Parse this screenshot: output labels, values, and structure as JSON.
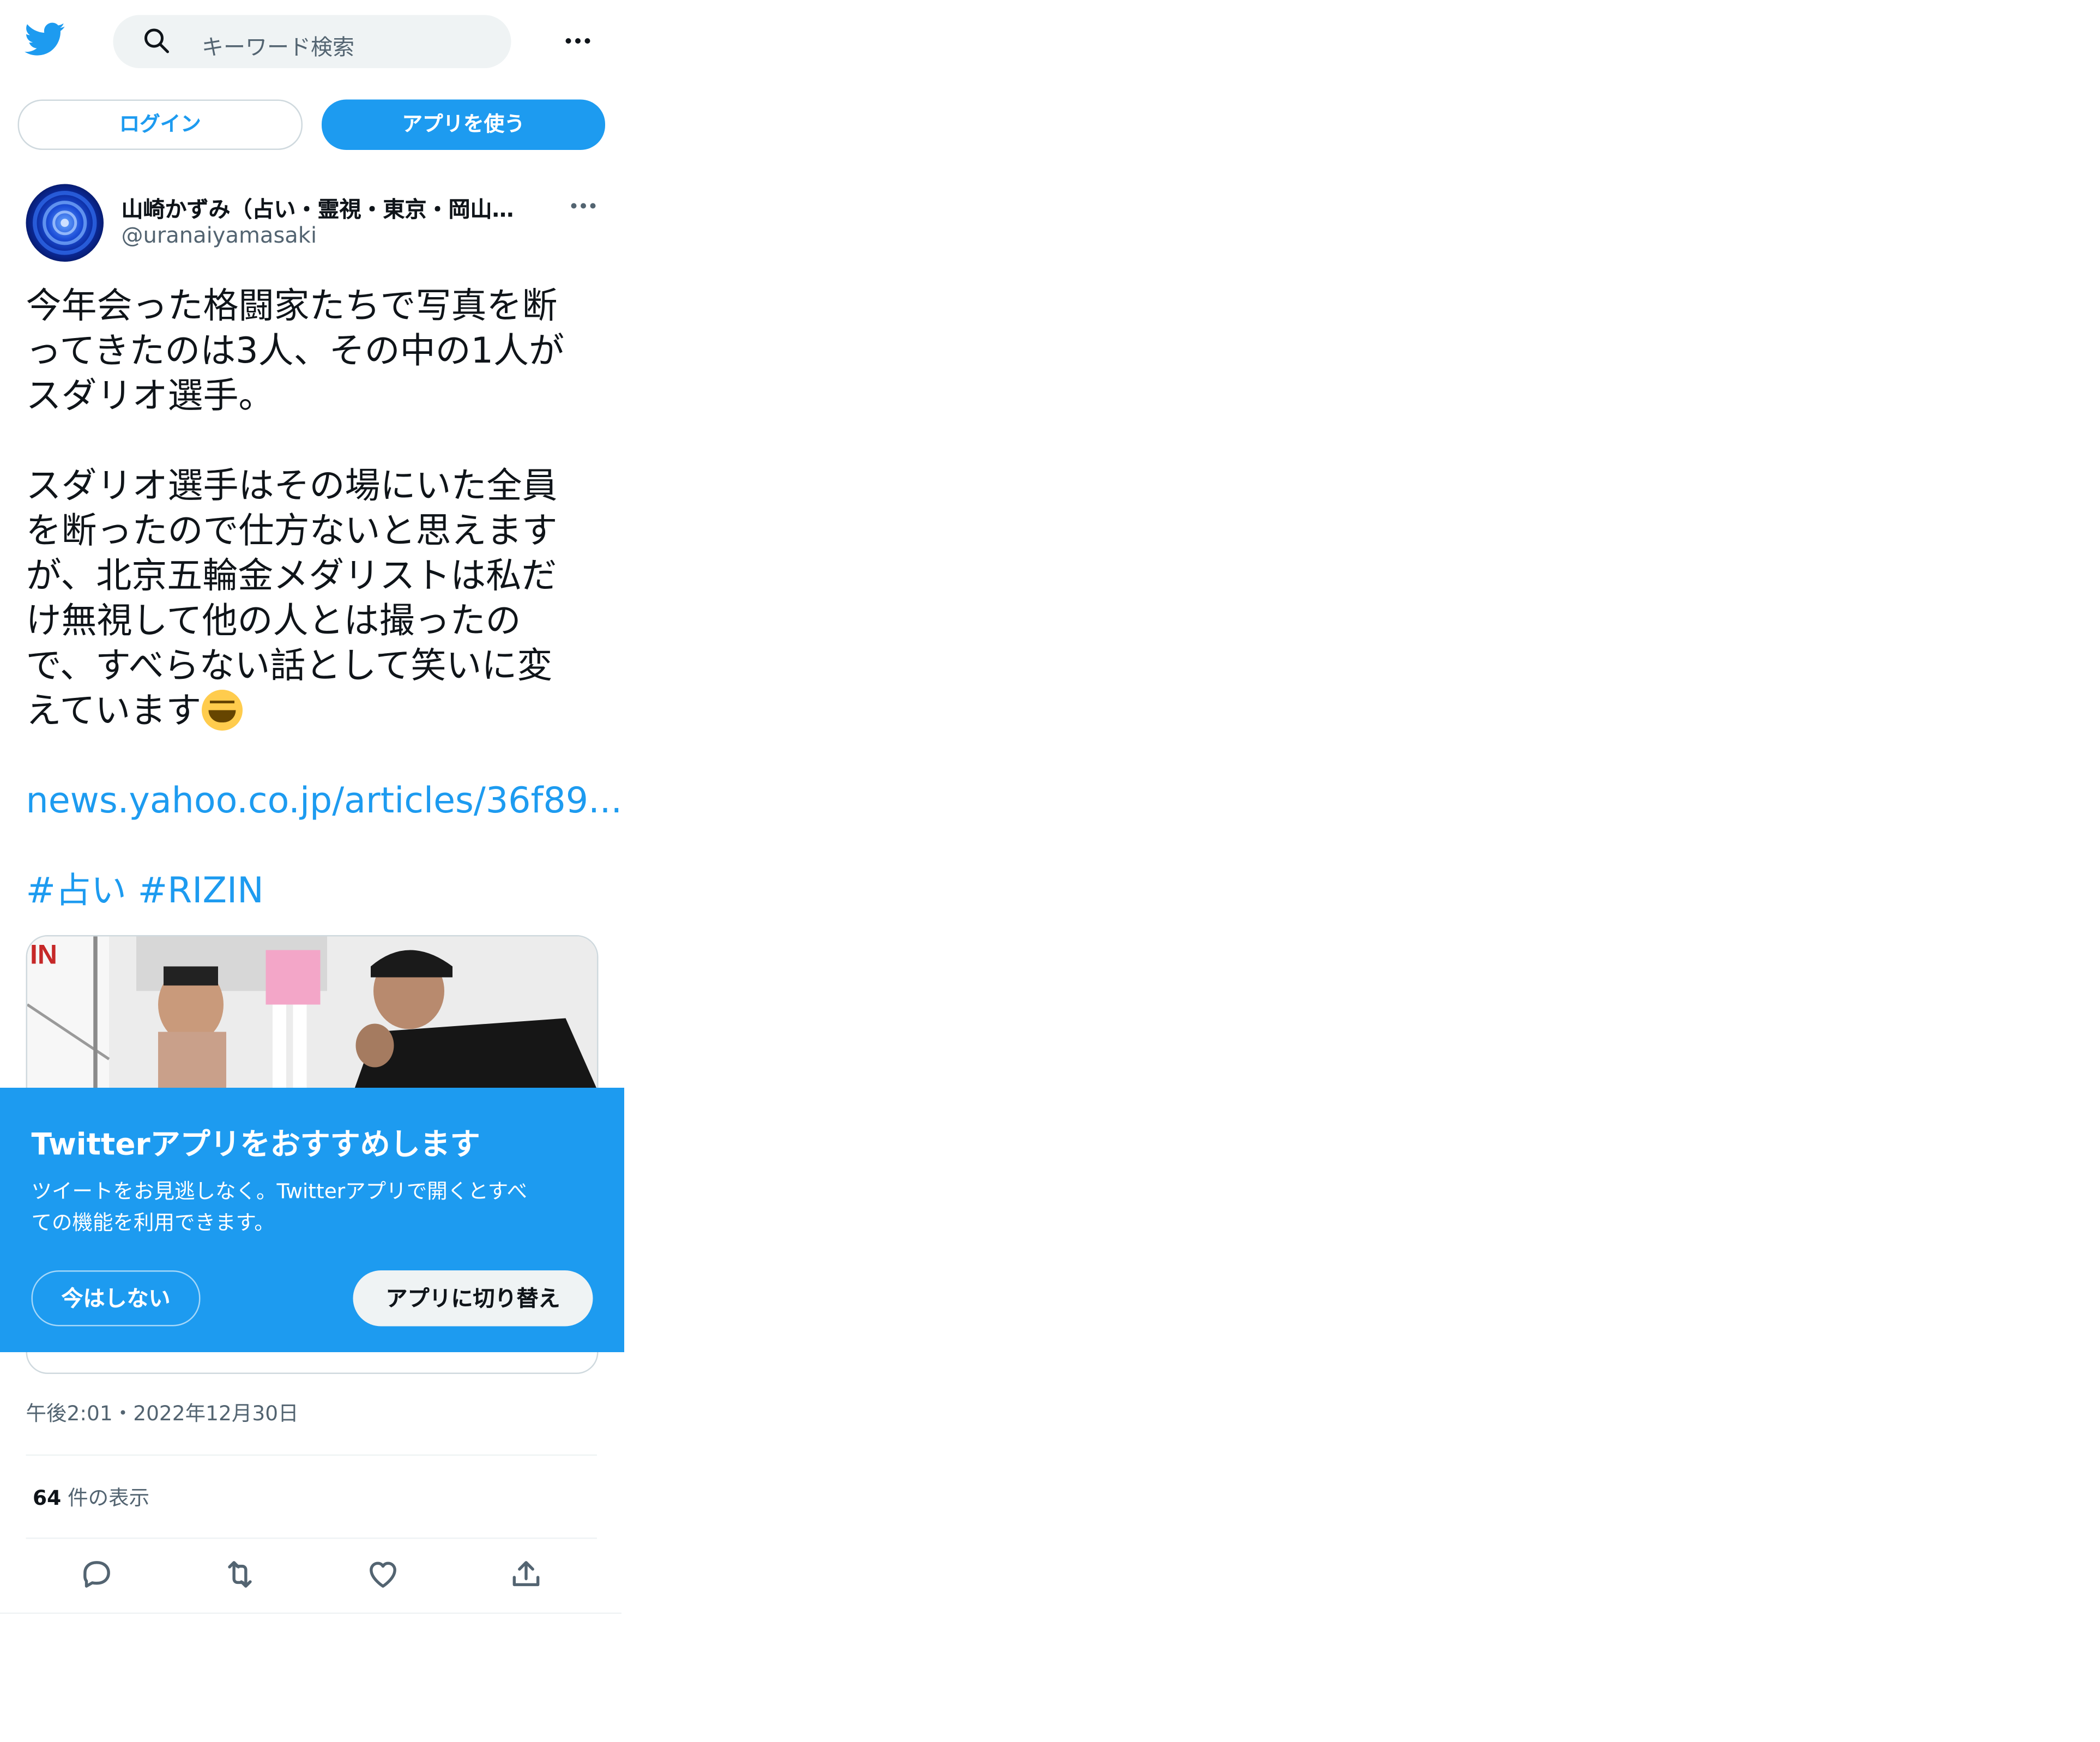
{
  "header": {
    "search_placeholder": "キーワード検索",
    "login_label": "ログイン",
    "use_app_label": "アプリを使う"
  },
  "author": {
    "name": "山崎かずみ（占い・霊視・東京・岡山…",
    "handle": "@uranaiyamasaki"
  },
  "tweet": {
    "line1": "今年会った格闘家たちで写真を断",
    "line2": "ってきたのは3人、その中の1人が",
    "line3": "スダリオ選手。",
    "line4": "スダリオ選手はその場にいた全員",
    "line5": "を断ったので仕方ないと思えます",
    "line6": "が、北京五輪金メダリストは私だ",
    "line7": "け無視して他の人とは撮ったの",
    "line8": "で、すべらない話として笑いに変",
    "line9": "えています",
    "link": "news.yahoo.co.jp/articles/36f89...",
    "hashtag1": "#占い",
    "hashtag2": "#RIZIN"
  },
  "banner": {
    "title": "Twitterアプリをおすすめします",
    "body_line1": "ツイートをお見逃しなく。Twitterアプリで開くとすべ",
    "body_line2": "ての機能を利用できます。",
    "not_now_label": "今はしない",
    "switch_label": "アプリに切り替え"
  },
  "meta": {
    "timestamp": "午後2:01・2022年12月30日",
    "views_count": "64",
    "views_label": "件の表示"
  },
  "colors": {
    "accent": "#1d9bf0",
    "text": "#0f1419",
    "secondary": "#536471",
    "border": "#cfd9de"
  },
  "icons": {
    "logo": "twitter-bird-icon",
    "search": "search-icon",
    "more": "more-dots-icon",
    "reply": "reply-icon",
    "retweet": "retweet-icon",
    "like": "heart-icon",
    "share": "share-icon"
  }
}
